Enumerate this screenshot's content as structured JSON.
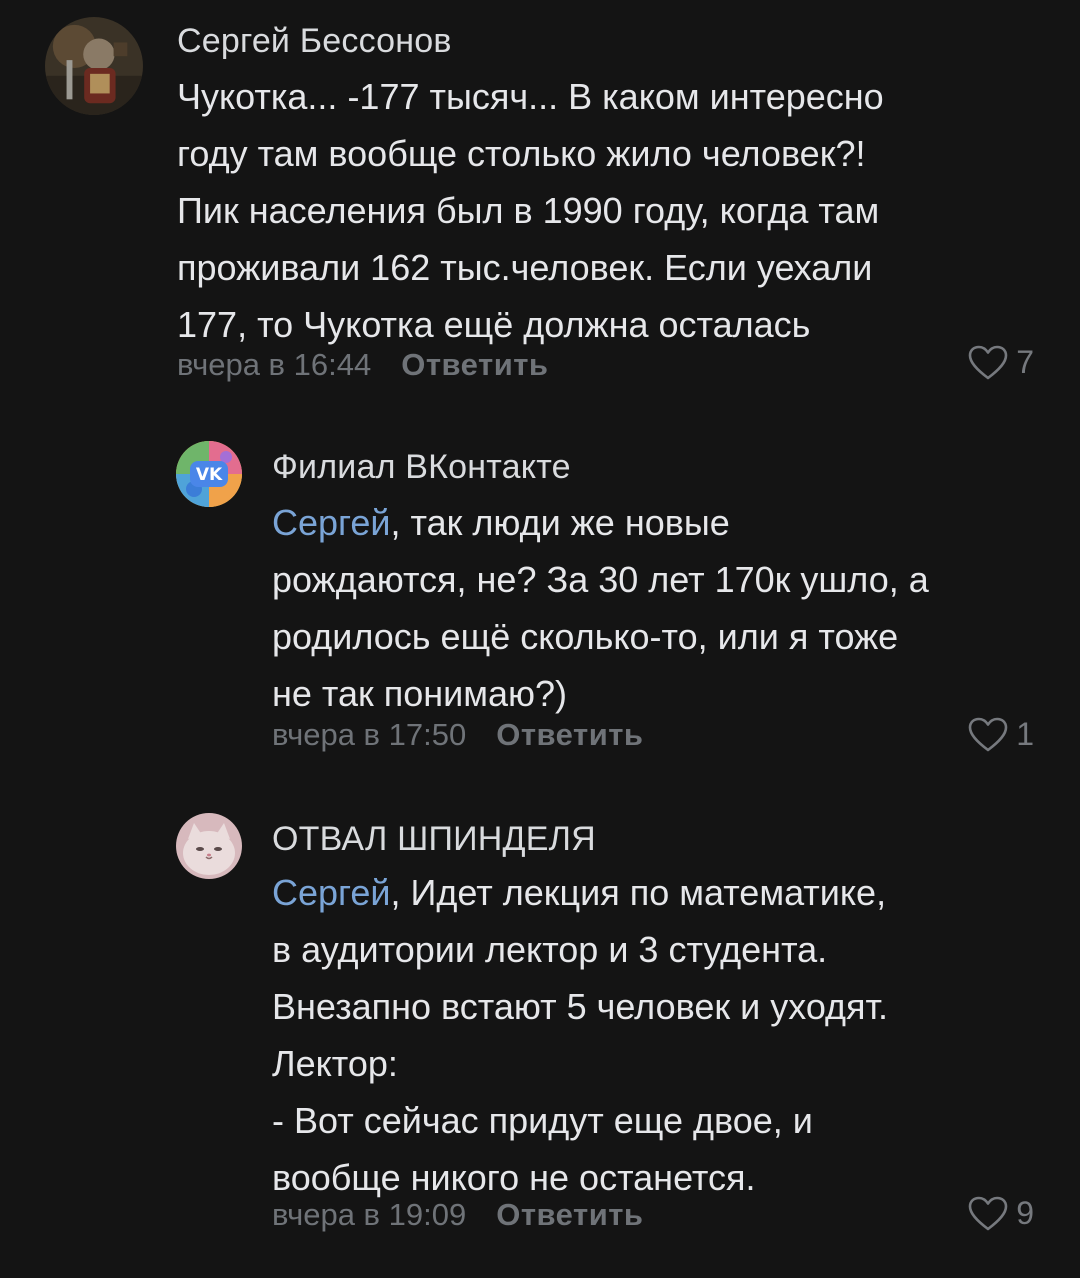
{
  "comments": [
    {
      "author": "Сергей Бессонов",
      "lines": [
        "Чукотка... -177 тысяч... В каком интересно",
        "году там вообще столько жило человек?!",
        "Пик населения был в 1990 году, когда там",
        "проживали 162 тыс.человек. Если уехали",
        "177, то Чукотка ещё должна осталась"
      ],
      "time": "вчера в 16:44",
      "reply_label": "Ответить",
      "likes": "7"
    },
    {
      "author": "Филиал ВКонтакте",
      "mention": "Сергей",
      "first_line_rest": ", так люди же новые",
      "lines": [
        "рождаются, не? За 30 лет 170к ушло, а",
        "родилось ещё сколько-то, или я тоже",
        "не так понимаю?)"
      ],
      "time": "вчера в 17:50",
      "reply_label": "Ответить",
      "likes": "1"
    },
    {
      "author": "ОТВАЛ ШПИНДЕЛЯ",
      "mention": "Сергей",
      "first_line_rest": ", Идет лекция по математике,",
      "lines": [
        "в аудитории лектор и 3 студента.",
        "Внезапно встают 5 человек и уходят.",
        "Лектор:",
        "- Вот сейчас придут еще двое, и",
        "вообще никого не останется."
      ],
      "time": "вчера в 19:09",
      "reply_label": "Ответить",
      "likes": "9"
    }
  ],
  "colors": {
    "background": "#141414",
    "mention": "#7aa4d6",
    "meta": "#6f7378"
  }
}
